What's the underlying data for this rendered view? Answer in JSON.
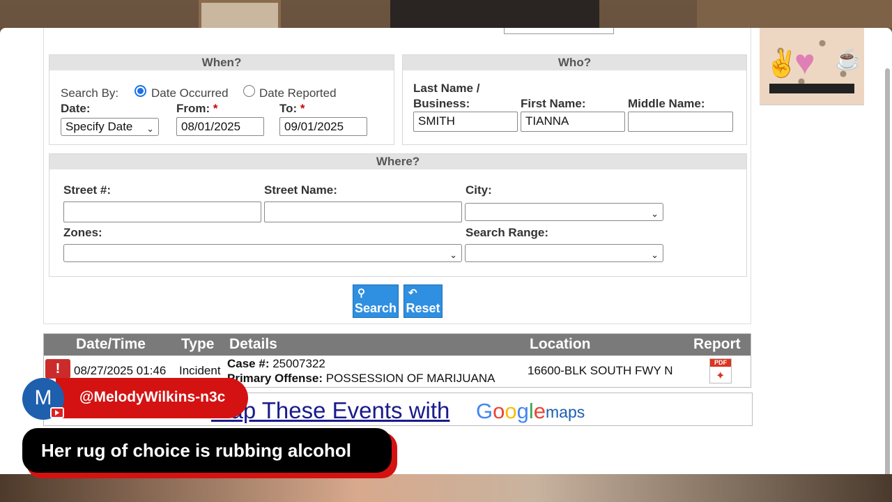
{
  "when": {
    "heading": "When?",
    "search_by_label": "Search By:",
    "radio_occurred": "Date Occurred",
    "radio_reported": "Date Reported",
    "date_label": "Date:",
    "date_select": "Specify Date",
    "from_label": "From:",
    "from_value": "08/01/2025",
    "to_label": "To:",
    "to_value": "09/01/2025",
    "required_mark": "*"
  },
  "who": {
    "heading": "Who?",
    "last_label_1": "Last Name /",
    "last_label_2": "Business:",
    "first_label": "First Name:",
    "middle_label": "Middle Name:",
    "last_value": "SMITH",
    "first_value": "TIANNA",
    "middle_value": ""
  },
  "where": {
    "heading": "Where?",
    "street_num_label": "Street #:",
    "street_name_label": "Street Name:",
    "city_label": "City:",
    "zones_label": "Zones:",
    "range_label": "Search Range:"
  },
  "buttons": {
    "search": "Search",
    "reset": "Reset"
  },
  "results": {
    "headers": [
      "Date/Time",
      "Type",
      "Details",
      "Location",
      "Report"
    ],
    "rows": [
      {
        "datetime": "08/27/2025 01:46",
        "type": "Incident",
        "case_label": "Case #:",
        "case_value": "25007322",
        "offense_label": "Primary Offense:",
        "offense_value": "POSSESSION OF MARIJUANA",
        "location": "16600-BLK SOUTH FWY N",
        "report_icon": "pdf-icon"
      }
    ],
    "warning_glyph": "!",
    "pdf_text": "PDF"
  },
  "map_link": {
    "text": "Map These Events with",
    "google": "Google",
    "maps": "maps"
  },
  "overlay": {
    "avatar_letter": "M",
    "channel": "@MelodyWilkins-n3c",
    "caption": "Her rug of choice is rubbing alcohol"
  },
  "colors": {
    "accent_blue": "#2f8fe0",
    "header_gray": "#7a7a7a",
    "caption_red": "#d41212"
  }
}
